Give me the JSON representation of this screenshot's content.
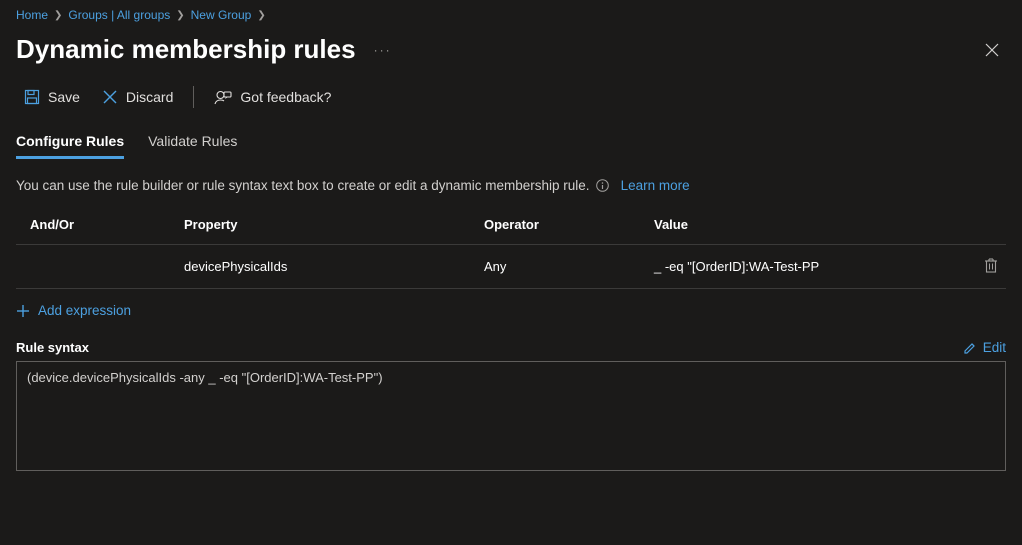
{
  "breadcrumb": {
    "items": [
      "Home",
      "Groups | All groups",
      "New Group"
    ]
  },
  "page": {
    "title": "Dynamic membership rules"
  },
  "toolbar": {
    "save": "Save",
    "discard": "Discard",
    "feedback": "Got feedback?"
  },
  "tabs": {
    "configure": "Configure Rules",
    "validate": "Validate Rules"
  },
  "description": {
    "text": "You can use the rule builder or rule syntax text box to create or edit a dynamic membership rule.",
    "learn_more": "Learn more"
  },
  "table": {
    "headers": {
      "and_or": "And/Or",
      "property": "Property",
      "operator": "Operator",
      "value": "Value"
    },
    "rows": [
      {
        "and_or": "",
        "property": "devicePhysicalIds",
        "operator": "Any",
        "value": "_ -eq \"[OrderID]:WA-Test-PP"
      }
    ]
  },
  "add_expression": "Add expression",
  "rule_syntax": {
    "label": "Rule syntax",
    "edit": "Edit",
    "content": "(device.devicePhysicalIds -any _ -eq \"[OrderID]:WA-Test-PP\")"
  }
}
